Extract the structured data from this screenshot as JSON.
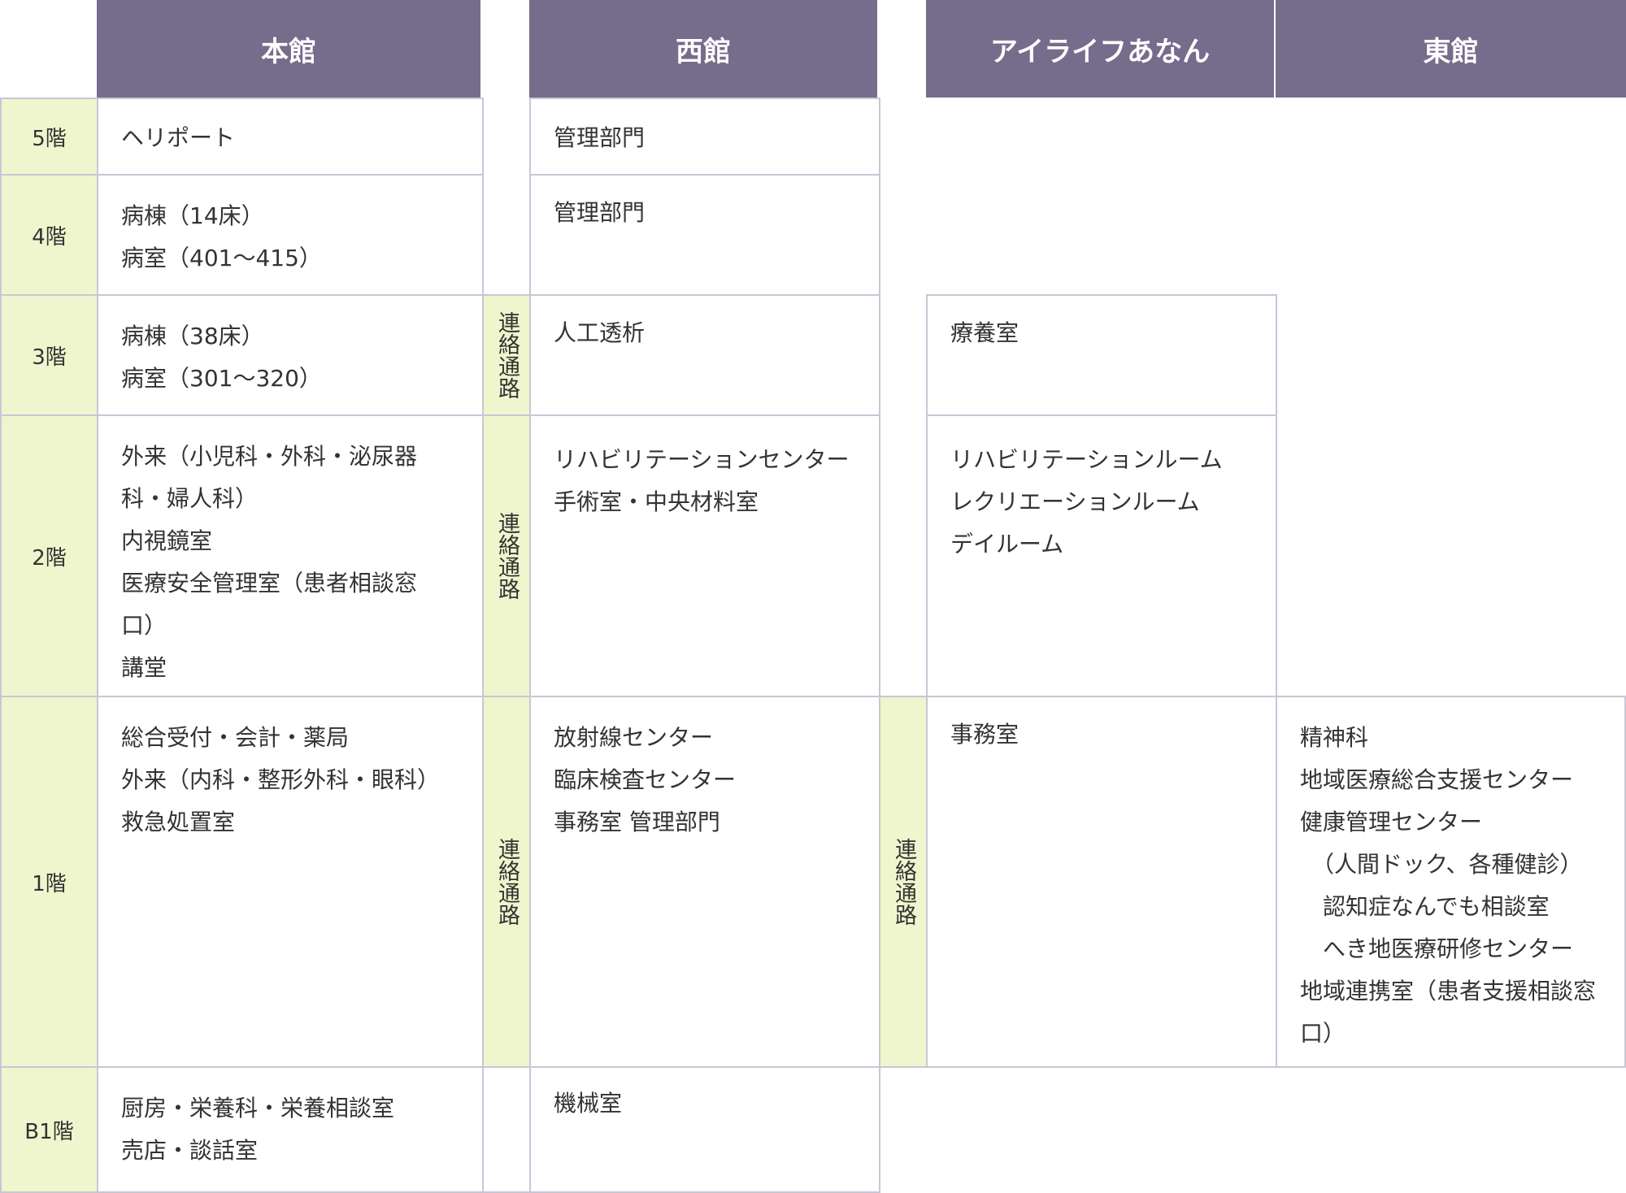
{
  "headers": {
    "honkan": "本館",
    "nishikan": "西館",
    "ailife": "アイライフあなん",
    "higashikan": "東館"
  },
  "floors": {
    "f5": "5階",
    "f4": "4階",
    "f3": "3階",
    "f2": "2階",
    "f1": "1階",
    "fb1": "B1階"
  },
  "corridor_label": "連絡通路",
  "honkan": {
    "f5": [
      "ヘリポート"
    ],
    "f4": [
      "病棟（14床）",
      "病室（401〜415）"
    ],
    "f3": [
      "病棟（38床）",
      "病室（301〜320）"
    ],
    "f2": [
      "外来（小児科・外科・泌尿器",
      "科・婦人科）",
      "内視鏡室",
      "医療安全管理室（患者相談窓",
      "口）",
      "講堂"
    ],
    "f1": [
      "総合受付・会計・薬局",
      "外来（内科・整形外科・眼科）",
      "救急処置室"
    ],
    "fb1": [
      "厨房・栄養科・栄養相談室",
      "売店・談話室"
    ]
  },
  "nishikan": {
    "f5": [
      "管理部門"
    ],
    "f4": [
      "管理部門"
    ],
    "f3": [
      "人工透析"
    ],
    "f2": [
      "リハビリテーションセンター",
      "手術室・中央材料室"
    ],
    "f1": [
      "放射線センター",
      "臨床検査センター",
      "事務室 管理部門"
    ],
    "fb1": [
      "機械室"
    ]
  },
  "ailife": {
    "f3": [
      "療養室"
    ],
    "f2": [
      "リハビリテーションルーム",
      "レクリエーションルーム",
      "デイルーム"
    ],
    "f1": [
      "事務室"
    ]
  },
  "higashikan": {
    "f1": [
      "精神科",
      "地域医療総合支援センター",
      "健康管理センター",
      "　（人間ドック、各種健診）",
      "　認知症なんでも相談室",
      "　へき地医療研修センター",
      "地域連携室（患者支援相談窓",
      "口）"
    ]
  },
  "colors": {
    "header_bg": "#766c8b",
    "floor_bg": "#eff5cd",
    "border": "#c9c6d6"
  }
}
